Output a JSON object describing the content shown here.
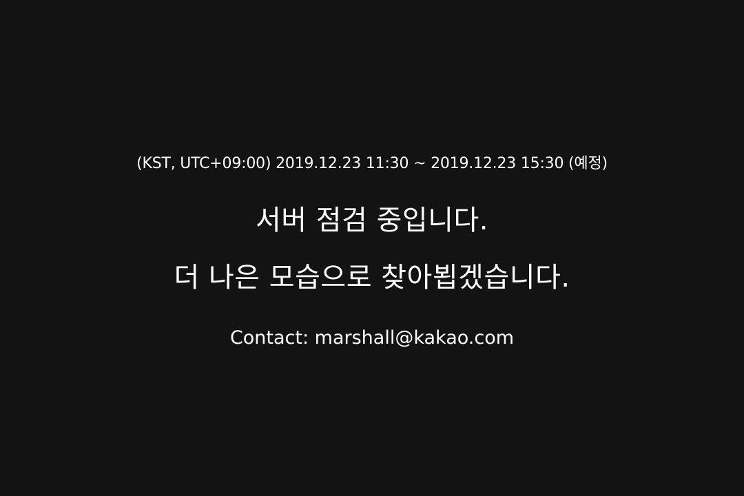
{
  "schedule": {
    "text": "(KST, UTC+09:00) 2019.12.23 11:30 ~ 2019.12.23 15:30 (예정)"
  },
  "headline": {
    "line1": "서버 점검 중입니다.",
    "line2": "더 나은 모습으로 찾아뵙겠습니다."
  },
  "contact": {
    "text": "Contact: marshall@kakao.com"
  },
  "colors": {
    "background": "#131313",
    "text": "#ffffff"
  }
}
